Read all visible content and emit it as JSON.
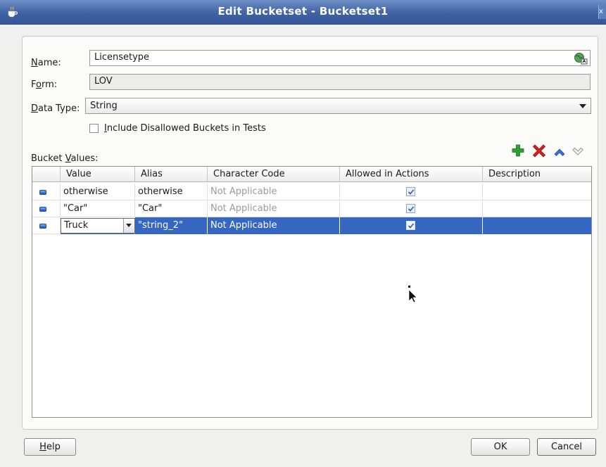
{
  "window": {
    "title": "Edit Bucketset - Bucketset1",
    "close_glyph": "x"
  },
  "form": {
    "name_label_pre": "",
    "name_label_mn": "N",
    "name_label_post": "ame:",
    "name_value": "Licensetype",
    "form_label_pre": "F",
    "form_label_mn": "o",
    "form_label_post": "rm:",
    "form_value": "LOV",
    "datatype_label_pre": "",
    "datatype_label_mn": "D",
    "datatype_label_post": "ata Type:",
    "datatype_value": "String",
    "include_label_pre": "",
    "include_label_mn": "I",
    "include_label_post": "nclude Disallowed Buckets in Tests"
  },
  "bucket_values": {
    "label_pre": "Bucket ",
    "label_mn": "V",
    "label_post": "alues:",
    "toolbar": [
      "add-icon",
      "delete-icon",
      "move-up-icon",
      "move-down-icon"
    ],
    "columns": [
      "Value",
      "Alias",
      "Character Code",
      "Allowed in Actions",
      "Description"
    ],
    "rows": [
      {
        "value": "otherwise",
        "alias": "otherwise",
        "code": "Not Applicable",
        "allowed": true,
        "description": ""
      },
      {
        "value": "\"Car\"",
        "alias": "\"Car\"",
        "code": "Not Applicable",
        "allowed": true,
        "description": ""
      },
      {
        "value": "Truck",
        "alias": "\"string_2\"",
        "code": "Not Applicable",
        "allowed": true,
        "description": ""
      }
    ],
    "selected_row": 2
  },
  "buttons": {
    "help_pre": "",
    "help_mn": "H",
    "help_post": "elp",
    "ok": "OK",
    "cancel": "Cancel"
  },
  "colors": {
    "titlebar": "#3f62a3",
    "selection": "#3466c2",
    "add_icon": "#2fa12f",
    "delete_icon": "#d2231c",
    "move_icon": "#3a6fd0"
  }
}
